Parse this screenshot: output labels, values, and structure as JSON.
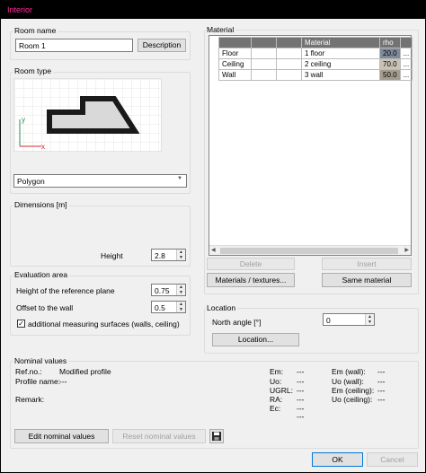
{
  "window": {
    "title": "Interior"
  },
  "room_name": {
    "group_label": "Room name",
    "value": "Room 1",
    "description_button": "Description"
  },
  "room_type": {
    "group_label": "Room type",
    "selected": "Polygon"
  },
  "dimensions": {
    "group_label": "Dimensions [m]",
    "height_label": "Height",
    "height_value": "2.8"
  },
  "evaluation_area": {
    "group_label": "Evaluation area",
    "ref_plane_label": "Height of the reference plane",
    "ref_plane_value": "0.75",
    "offset_label": "Offset to the wall",
    "offset_value": "0.5",
    "additional_label": "additional measuring surfaces (walls, ceiling)",
    "additional_checked": true
  },
  "material": {
    "group_label": "Material",
    "headers": [
      "",
      "",
      "",
      "Material",
      "rho"
    ],
    "rows": [
      {
        "surface": "Floor",
        "material": "1 floor",
        "rho": "20.0",
        "more": "..."
      },
      {
        "surface": "Ceiling",
        "material": "2 ceiling",
        "rho": "70.0",
        "more": "..."
      },
      {
        "surface": "Wall",
        "material": "3 wall",
        "rho": "50.0",
        "more": "..."
      }
    ],
    "delete_button": "Delete",
    "insert_button": "Insert",
    "materials_textures_button": "Materials / textures...",
    "same_material_button": "Same material"
  },
  "location": {
    "group_label": "Location",
    "north_angle_label": "North angle [°]",
    "north_angle_value": "0",
    "location_button": "Location..."
  },
  "nominal": {
    "group_label": "Nominal values",
    "refno_label": "Ref.no.:",
    "refno_value": "Modified profile",
    "profile_label": "Profile name:",
    "profile_value": "---",
    "remark_label": "Remark:",
    "metrics_left": [
      {
        "label": "Em:",
        "value": "---"
      },
      {
        "label": "Uo:",
        "value": "---"
      },
      {
        "label": "UGRL:",
        "value": "---"
      },
      {
        "label": "RA:",
        "value": "---"
      },
      {
        "label": "Ec:",
        "value": "---"
      }
    ],
    "ec_extra": "---",
    "metrics_right": [
      {
        "label": "Em (wall):",
        "value": "---"
      },
      {
        "label": "Uo (wall):",
        "value": "---"
      },
      {
        "label": "Em (ceiling):",
        "value": "---"
      },
      {
        "label": "Uo (ceiling):",
        "value": "---"
      }
    ],
    "edit_button": "Edit nominal values",
    "reset_button": "Reset nominal values"
  },
  "footer": {
    "ok_button": "OK",
    "cancel_button": "Cancel"
  }
}
